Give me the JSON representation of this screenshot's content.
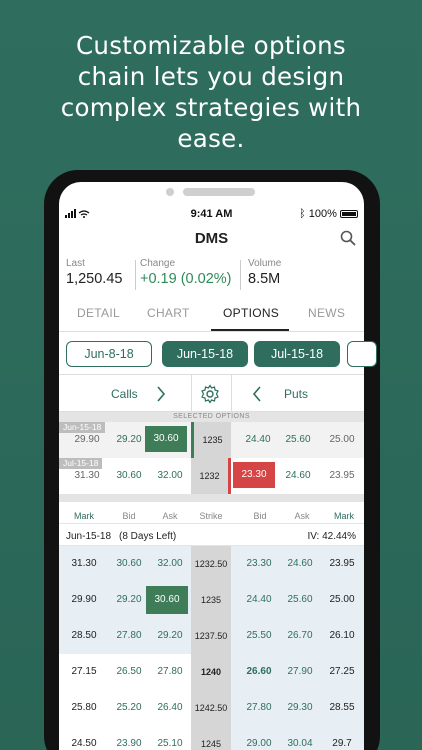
{
  "headline": [
    "Customizable options",
    "chain lets you design",
    "complex strategies with",
    "ease."
  ],
  "status_bar": {
    "time": "9:41 AM",
    "battery": "100%"
  },
  "ticker": "DMS",
  "quote": {
    "last_label": "Last",
    "last_value": "1,250.45",
    "change_label": "Change",
    "change_value": "+0.19 (0.02%)",
    "volume_label": "Volume",
    "volume_value": "8.5M"
  },
  "tabs": [
    "DETAIL",
    "CHART",
    "OPTIONS",
    "NEWS"
  ],
  "dates": [
    "Jun-8-18",
    "Jun-15-18",
    "Jul-15-18"
  ],
  "calls_label": "Calls",
  "puts_label": "Puts",
  "selected_header": "SELECTED OPTIONS",
  "selected": [
    {
      "date": "Jun-15-18",
      "mark": "29.90",
      "bid": "29.20",
      "ask": "30.60",
      "strike": "1235",
      "pbid": "24.40",
      "pask": "25.60",
      "pmark": "25.00"
    },
    {
      "date": "Jul-15-18",
      "mark": "31.30",
      "bid": "30.60",
      "ask": "32.00",
      "strike": "1232",
      "pbid": "23.30",
      "pask": "24.60",
      "pmark": "23.95"
    }
  ],
  "columns": [
    "Mark",
    "Bid",
    "Ask",
    "Strike",
    "Bid",
    "Ask",
    "Mark"
  ],
  "expiry": {
    "label": "Jun-15-18",
    "days": "(8 Days Left)",
    "iv": "IV: 42.44%"
  },
  "chain": [
    {
      "mark": "31.30",
      "bid": "30.60",
      "ask": "32.00",
      "strike": "1232.50",
      "pbid": "23.30",
      "pask": "24.60",
      "pmark": "23.95"
    },
    {
      "mark": "29.90",
      "bid": "29.20",
      "ask": "30.60",
      "strike": "1235",
      "pbid": "24.40",
      "pask": "25.60",
      "pmark": "25.00"
    },
    {
      "mark": "28.50",
      "bid": "27.80",
      "ask": "29.20",
      "strike": "1237.50",
      "pbid": "25.50",
      "pask": "26.70",
      "pmark": "26.10"
    },
    {
      "mark": "27.15",
      "bid": "26.50",
      "ask": "27.80",
      "strike": "1240",
      "pbid": "26.60",
      "pask": "27.90",
      "pmark": "27.25"
    },
    {
      "mark": "25.80",
      "bid": "25.20",
      "ask": "26.40",
      "strike": "1242.50",
      "pbid": "27.80",
      "pask": "29.30",
      "pmark": "28.55"
    },
    {
      "mark": "24.50",
      "bid": "23.90",
      "ask": "25.10",
      "strike": "1245",
      "pbid": "29.00",
      "pask": "30.04",
      "pmark": "29.7"
    }
  ]
}
